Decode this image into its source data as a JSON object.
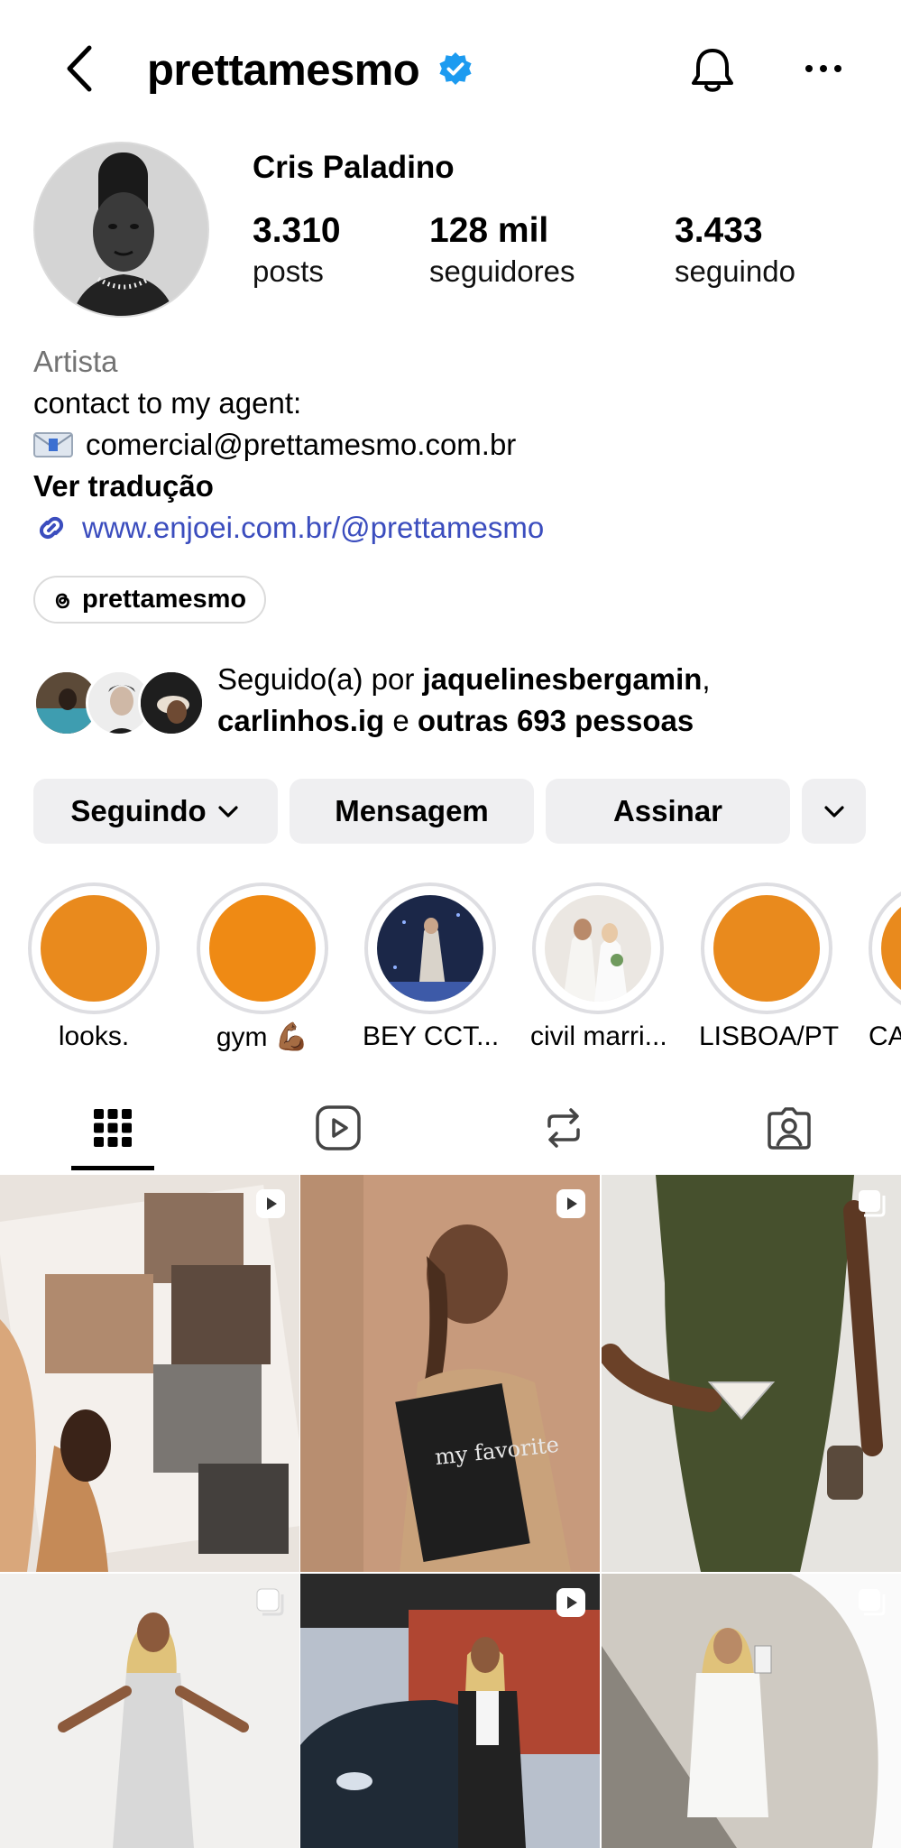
{
  "header": {
    "username": "prettamesmo",
    "verified": true
  },
  "profile": {
    "full_name": "Cris Paladino",
    "stats": [
      {
        "value": "3.310",
        "label": "posts"
      },
      {
        "value": "128 mil",
        "label": "seguidores"
      },
      {
        "value": "3.433",
        "label": "seguindo"
      }
    ],
    "category": "Artista",
    "bio_line": "contact to my agent:",
    "email": "comercial@prettamesmo.com.br",
    "translate_label": "Ver tradução",
    "link": "www.enjoei.com.br/@prettamesmo",
    "threads_handle": "prettamesmo"
  },
  "followed_by": {
    "prefix": "Seguido(a) por ",
    "user1": "jaquelinesbergamin",
    "sep": ",",
    "user2": "carlinhos.ig",
    "conj": " e ",
    "others": "outras 693 pessoas"
  },
  "actions": {
    "following": "Seguindo",
    "message": "Mensagem",
    "subscribe": "Assinar"
  },
  "highlights": [
    {
      "label": "looks.",
      "color": "#e98a1d"
    },
    {
      "label": "gym 💪🏾",
      "color": "#ef8a14"
    },
    {
      "label": "BEY CCT...",
      "color": "#1d2a4e"
    },
    {
      "label": "civil marri...",
      "color": "#e8e4df"
    },
    {
      "label": "LISBOA/PT",
      "color": "#e98a1d"
    },
    {
      "label": "CA",
      "color": "#e98a1d"
    }
  ],
  "tabs": [
    "grid",
    "reels",
    "reposts",
    "tagged"
  ],
  "grid_posts": [
    {
      "type": "reel"
    },
    {
      "type": "reel",
      "caption": "my favorite"
    },
    {
      "type": "carousel"
    },
    {
      "type": "carousel"
    },
    {
      "type": "reel"
    },
    {
      "type": "carousel"
    }
  ],
  "colors": {
    "link": "#3b4dbe",
    "verified": "#1d9bf0",
    "button_bg": "#efeff1",
    "muted_text": "#737373"
  }
}
